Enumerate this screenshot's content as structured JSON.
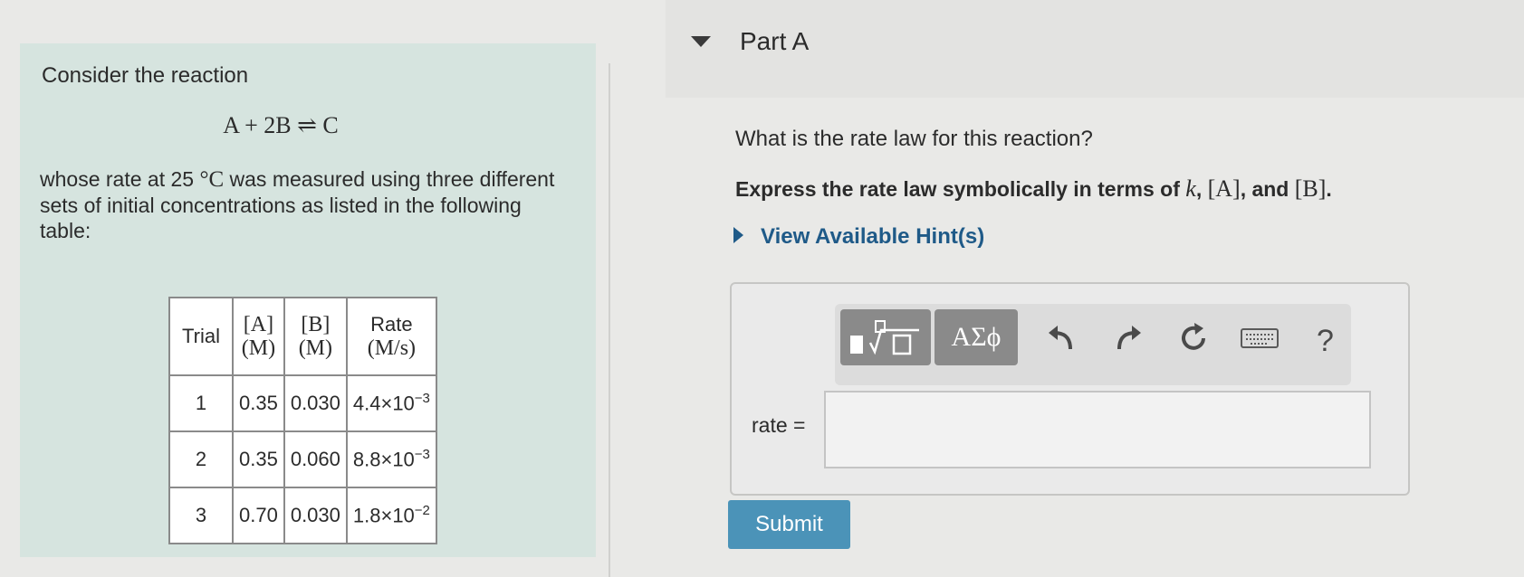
{
  "problem": {
    "intro": "Consider the reaction",
    "equation": "A + 2B ⇌ C",
    "desc_before": "whose rate at 25",
    "desc_unit": "°C",
    "desc_after": " was measured using three different sets of initial concentrations as listed in the following table:"
  },
  "table": {
    "headers": [
      {
        "top": "Trial",
        "bottom": ""
      },
      {
        "top": "[A]",
        "bottom": "(M)"
      },
      {
        "top": "[B]",
        "bottom": "(M)"
      },
      {
        "top": "Rate",
        "bottom": "(M/s)"
      }
    ],
    "rows": [
      {
        "trial": "1",
        "a": "0.35",
        "b": "0.030",
        "rate_base": "4.4×10",
        "rate_exp": "−3"
      },
      {
        "trial": "2",
        "a": "0.35",
        "b": "0.060",
        "rate_base": "8.8×10",
        "rate_exp": "−3"
      },
      {
        "trial": "3",
        "a": "0.70",
        "b": "0.030",
        "rate_base": "1.8×10",
        "rate_exp": "−2"
      }
    ]
  },
  "part": {
    "title": "Part A",
    "question": "What is the rate law for this reaction?",
    "instruction_prefix": "Express the rate law symbolically in terms of ",
    "instruction_k": "k",
    "instruction_sep1": ", ",
    "instruction_a": "[A]",
    "instruction_sep2": ", and ",
    "instruction_b": "[B]",
    "instruction_end": ".",
    "hint_label": "View Available Hint(s)"
  },
  "toolbar": {
    "symbols_label": "ΑΣϕ",
    "help_label": "?"
  },
  "answer": {
    "label": "rate =",
    "value": ""
  },
  "submit_label": "Submit"
}
